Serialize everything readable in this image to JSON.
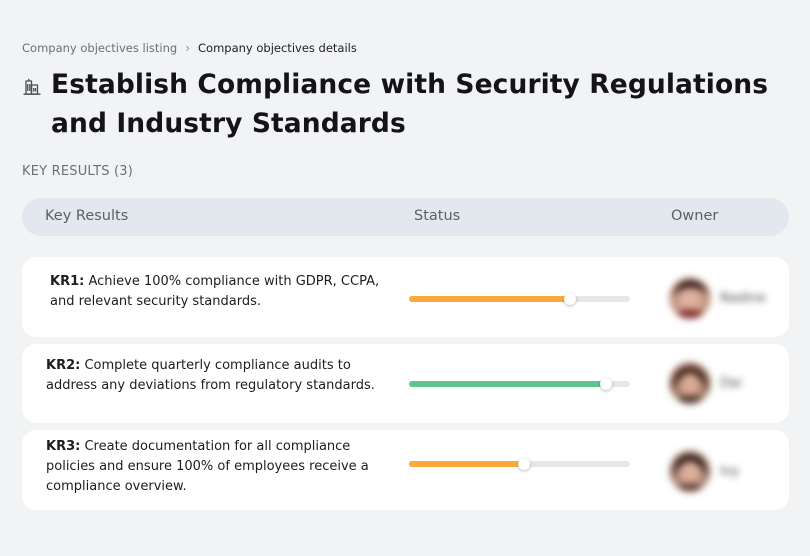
{
  "breadcrumb": {
    "parent": "Company objectives listing",
    "separator": "›",
    "current": "Company objectives details"
  },
  "objective": {
    "icon": "building-icon",
    "title": "Establish Compliance with Security Regulations and Industry Standards"
  },
  "key_results_section": {
    "label": "KEY RESULTS (3)"
  },
  "table": {
    "headers": {
      "key_results": "Key Results",
      "status": "Status",
      "owner": "Owner"
    },
    "rows": [
      {
        "code": "KR1:",
        "text": "Achieve 100% compliance with GDPR, CCPA, and relevant security standards.",
        "progress": 0.73,
        "progress_color": "#fda93a",
        "owner_name": "Nadine"
      },
      {
        "code": "KR2:",
        "text": "Complete quarterly compliance audits to address any deviations from regulatory standards.",
        "progress": 0.89,
        "progress_color": "#5cc68e",
        "owner_name": "Dai"
      },
      {
        "code": "KR3:",
        "text": "Create documentation for all compliance policies and ensure 100% of employees receive a compliance overview.",
        "progress": 0.52,
        "progress_color": "#fda93a",
        "owner_name": "Ivy"
      }
    ]
  }
}
